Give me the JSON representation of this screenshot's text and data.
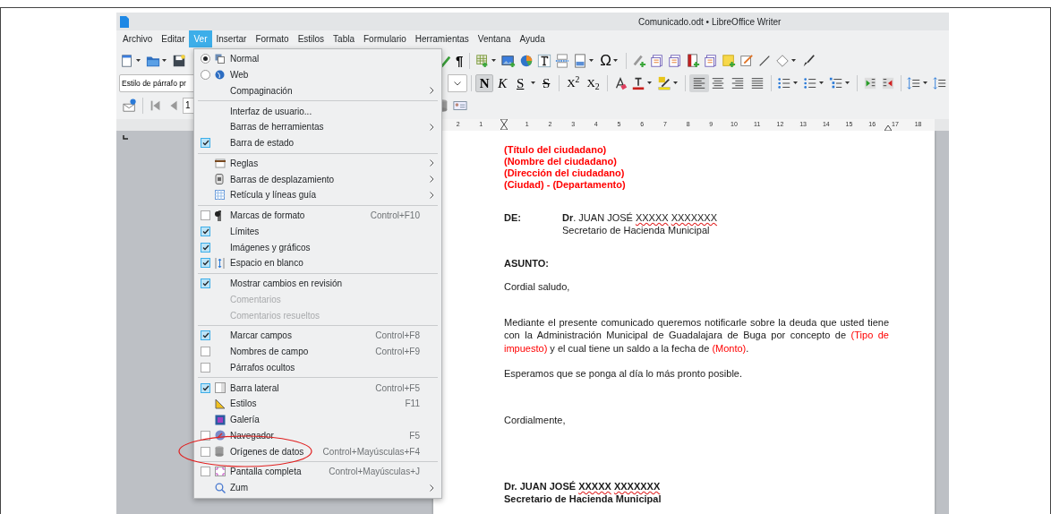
{
  "window": {
    "title": "Comunicado.odt • LibreOffice Writer"
  },
  "menubar": [
    {
      "label": "Archivo",
      "selected": false
    },
    {
      "label": "Editar",
      "selected": false
    },
    {
      "label": "Ver",
      "selected": true
    },
    {
      "label": "Insertar",
      "selected": false
    },
    {
      "label": "Formato",
      "selected": false
    },
    {
      "label": "Estilos",
      "selected": false
    },
    {
      "label": "Tabla",
      "selected": false
    },
    {
      "label": "Formulario",
      "selected": false
    },
    {
      "label": "Herramientas",
      "selected": false
    },
    {
      "label": "Ventana",
      "selected": false
    },
    {
      "label": "Ayuda",
      "selected": false
    }
  ],
  "toolbar": {
    "formatting_marks": "¶",
    "special_character": "Ω",
    "paragraph_style": "Estilo de párrafo pr",
    "page_number": "1",
    "format_buttons": [
      {
        "label": "N",
        "selected": true
      },
      {
        "label": "K",
        "selected": false
      },
      {
        "label": "S",
        "selected": false
      },
      {
        "label": "S",
        "selected": false
      }
    ],
    "script_buttons": [
      {
        "label": "X$^{2}$"
      },
      {
        "label": "X$_{2}$"
      }
    ],
    "alignment": [
      {
        "selected": true
      },
      {
        "selected": false
      },
      {
        "selected": false
      },
      {
        "selected": false
      }
    ]
  },
  "ruler": {
    "labels": [
      "2",
      "1",
      "1",
      "2",
      "3",
      "4",
      "5",
      "6",
      "7",
      "8",
      "9",
      "10",
      "11",
      "12",
      "13",
      "14",
      "15",
      "16",
      "17",
      "18"
    ]
  },
  "view_menu": {
    "sections": [
      [
        {
          "label": "Normal",
          "kind": "radio",
          "selected": true,
          "disabled": false,
          "submenu": false
        },
        {
          "label": "Web",
          "kind": "radio",
          "selected": false,
          "disabled": false,
          "submenu": false
        },
        {
          "label": "Compaginación",
          "kind": "plain",
          "disabled": false,
          "submenu": true
        }
      ],
      [
        {
          "label": "Interfaz de usuario...",
          "kind": "plain",
          "disabled": false,
          "submenu": false
        },
        {
          "label": "Barras de herramientas",
          "kind": "plain",
          "disabled": false,
          "submenu": true
        },
        {
          "label": "Barra de estado",
          "kind": "check",
          "checked": true,
          "disabled": false,
          "submenu": false
        }
      ],
      [
        {
          "label": "Reglas",
          "kind": "plain",
          "disabled": false,
          "submenu": true
        },
        {
          "label": "Barras de desplazamiento",
          "kind": "plain",
          "disabled": false,
          "submenu": true
        },
        {
          "label": "Retícula y líneas guía",
          "kind": "plain",
          "disabled": false,
          "submenu": true
        }
      ],
      [
        {
          "label": "Marcas de formato",
          "kind": "check",
          "checked": false,
          "disabled": false,
          "submenu": false,
          "shortcut": "Control+F10"
        },
        {
          "label": "Límites",
          "kind": "check",
          "checked": true,
          "disabled": false,
          "submenu": false
        },
        {
          "label": "Imágenes y gráficos",
          "kind": "check",
          "checked": true,
          "disabled": false,
          "submenu": false
        },
        {
          "label": "Espacio en blanco",
          "kind": "check",
          "checked": true,
          "disabled": false,
          "submenu": false
        }
      ],
      [
        {
          "label": "Mostrar cambios en revisión",
          "kind": "check",
          "checked": true,
          "disabled": false,
          "submenu": false
        },
        {
          "label": "Comentarios",
          "kind": "plain",
          "disabled": true,
          "submenu": false
        },
        {
          "label": "Comentarios resueltos",
          "kind": "plain",
          "disabled": true,
          "submenu": false
        }
      ],
      [
        {
          "label": "Marcar campos",
          "kind": "check",
          "checked": true,
          "disabled": false,
          "submenu": false,
          "shortcut": "Control+F8"
        },
        {
          "label": "Nombres de campo",
          "kind": "check",
          "checked": false,
          "disabled": false,
          "submenu": false,
          "shortcut": "Control+F9"
        },
        {
          "label": "Párrafos ocultos",
          "kind": "check",
          "checked": false,
          "disabled": false,
          "submenu": false
        }
      ],
      [
        {
          "label": "Barra lateral",
          "kind": "check",
          "checked": true,
          "disabled": false,
          "submenu": false,
          "shortcut": "Control+F5"
        },
        {
          "label": "Estilos",
          "kind": "plain",
          "disabled": false,
          "submenu": false,
          "shortcut": "F11"
        },
        {
          "label": "Galería",
          "kind": "plain",
          "disabled": false,
          "submenu": false
        },
        {
          "label": "Navegador",
          "kind": "check",
          "checked": false,
          "disabled": false,
          "submenu": false,
          "shortcut": "F5"
        },
        {
          "label": "Orígenes de datos",
          "kind": "check",
          "checked": false,
          "disabled": false,
          "submenu": false,
          "shortcut": "Control+Mayúsculas+F4"
        }
      ],
      [
        {
          "label": "Pantalla completa",
          "kind": "check",
          "checked": false,
          "disabled": false,
          "submenu": false,
          "shortcut": "Control+Mayúsculas+J"
        },
        {
          "label": "Zum",
          "kind": "plain",
          "disabled": false,
          "submenu": true
        }
      ]
    ]
  },
  "document": {
    "blocks": [
      {
        "kind": "address",
        "lines": [
          "(Título del ciudadano)",
          "(Nombre del ciudadano)",
          "(Dirección del ciudadano)",
          "(Ciudad) - (Departamento)"
        ]
      },
      {
        "kind": "sender",
        "label": "DE:",
        "lines": [
          [
            {
              "text": "Dr",
              "kind": "bold"
            },
            {
              "text": ". JUAN JOSÉ ",
              "kind": "plain"
            },
            {
              "text": "XXXXX XXXXXXX",
              "kind": "misspelled"
            }
          ],
          [
            {
              "text": "Secretario de Hacienda Municipal",
              "kind": "plain"
            }
          ]
        ]
      },
      {
        "kind": "heading",
        "text": "ASUNTO:"
      },
      {
        "kind": "paragraph",
        "segments": [
          {
            "text": "Cordial saludo,",
            "kind": "plain"
          }
        ]
      },
      {
        "kind": "paragraph",
        "segments": [
          {
            "text": "Mediante el presente comunicado queremos notificarle sobre la deuda que usted tiene con la Administración Municipal de Guadalajara de Buga por concepto de ",
            "kind": "plain"
          },
          {
            "text": "(Tipo de impuesto)",
            "kind": "placeholder"
          },
          {
            "text": " y el cual tiene un saldo a la fecha de ",
            "kind": "plain"
          },
          {
            "text": "(Monto)",
            "kind": "placeholder"
          },
          {
            "text": ".",
            "kind": "plain"
          }
        ]
      },
      {
        "kind": "paragraph",
        "segments": [
          {
            "text": "Esperamos que se ponga al día lo más pronto posible.",
            "kind": "plain"
          }
        ]
      },
      {
        "kind": "paragraph",
        "segments": [
          {
            "text": "Cordialmente,",
            "kind": "plain"
          }
        ]
      },
      {
        "kind": "signature",
        "lines": [
          [
            {
              "text": "Dr. JUAN JOSÉ ",
              "kind": "bold"
            },
            {
              "text": "XXXXX XXXXXXX",
              "kind": "bold_misspelled"
            }
          ],
          [
            {
              "text": "Secretario de Hacienda Municipal",
              "kind": "bold"
            }
          ]
        ]
      }
    ]
  }
}
